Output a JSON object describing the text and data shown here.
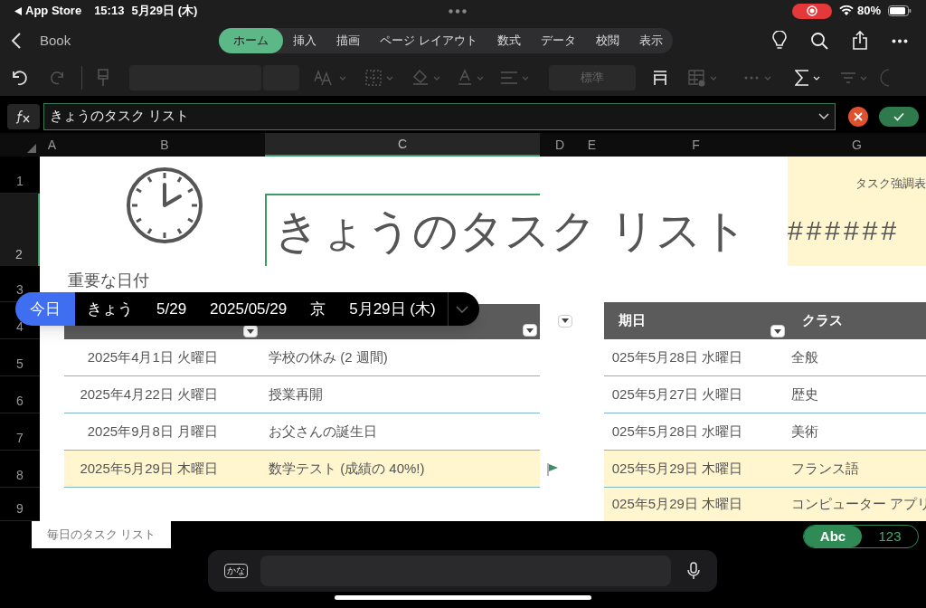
{
  "status_bar": {
    "back_app": "App Store",
    "time": "15:13",
    "date": "5月29日 (木)",
    "battery": "80%"
  },
  "ribbon": {
    "back_label": "Book",
    "tabs": [
      {
        "label": "ホーム",
        "selected": true
      },
      {
        "label": "挿入",
        "selected": false
      },
      {
        "label": "描画",
        "selected": false
      },
      {
        "label": "ページ レイアウト",
        "selected": false
      },
      {
        "label": "数式",
        "selected": false
      },
      {
        "label": "データ",
        "selected": false
      },
      {
        "label": "校閲",
        "selected": false
      },
      {
        "label": "表示",
        "selected": false
      }
    ]
  },
  "toolbar": {
    "number_format": "標準"
  },
  "formula_bar": {
    "value": "きょうのタスク リスト"
  },
  "columns": [
    {
      "label": "A",
      "selected": false
    },
    {
      "label": "B",
      "selected": false
    },
    {
      "label": "C",
      "selected": true
    },
    {
      "label": "D",
      "selected": false
    },
    {
      "label": "E",
      "selected": false
    },
    {
      "label": "F",
      "selected": false
    },
    {
      "label": "G",
      "selected": false
    }
  ],
  "rows": [
    {
      "label": "1",
      "selected": false
    },
    {
      "label": "2",
      "selected": true
    },
    {
      "label": "3",
      "selected": false
    },
    {
      "label": "4",
      "selected": false
    },
    {
      "label": "5",
      "selected": false
    },
    {
      "label": "6",
      "selected": false
    },
    {
      "label": "7",
      "selected": false
    },
    {
      "label": "8",
      "selected": false
    },
    {
      "label": "9",
      "selected": false
    }
  ],
  "sheet": {
    "title": "きょうのタスク リスト",
    "highlight_label": "タスク強調表",
    "highlight_value": "######",
    "section_title": "重要な日付",
    "dates_table": {
      "rows": [
        {
          "date": "2025年4月1日 火曜日",
          "event": "学校の休み (2 週間)",
          "highlighted": false,
          "flagged": false
        },
        {
          "date": "2025年4月22日 火曜日",
          "event": "授業再開",
          "highlighted": false,
          "flagged": false
        },
        {
          "date": "2025年9月8日 月曜日",
          "event": "お父さんの誕生日",
          "highlighted": false,
          "flagged": false
        },
        {
          "date": "2025年5月29日 木曜日",
          "event": "数学テスト (成績の 40%!)",
          "highlighted": true,
          "flagged": true
        }
      ]
    },
    "tasks_table": {
      "headers": [
        "期日",
        "クラス"
      ],
      "rows": [
        {
          "date": "025年5月28日 水曜日",
          "class": "全般",
          "highlighted": false
        },
        {
          "date": "025年5月27日 火曜日",
          "class": "歴史",
          "highlighted": false
        },
        {
          "date": "025年5月28日 水曜日",
          "class": "美術",
          "highlighted": false
        },
        {
          "date": "025年5月29日 木曜日",
          "class": "フランス語",
          "highlighted": true
        },
        {
          "date": "025年5月29日 木曜日",
          "class": "コンピューター アプリ",
          "highlighted": true
        }
      ]
    }
  },
  "autocomplete": {
    "items": [
      {
        "label": "今日",
        "selected": true
      },
      {
        "label": "きょう",
        "selected": false
      },
      {
        "label": "5/29",
        "selected": false
      },
      {
        "label": "2025/05/29",
        "selected": false
      },
      {
        "label": "京",
        "selected": false
      },
      {
        "label": "5月29日 (木)",
        "selected": false
      }
    ]
  },
  "sheet_tabs": [
    {
      "label": "毎日のタスク リスト",
      "selected": true
    }
  ],
  "keyboard_modes": [
    {
      "label": "Abc",
      "selected": true
    },
    {
      "label": "123",
      "selected": false
    }
  ],
  "input_bar": {
    "kana_key": "かな"
  }
}
